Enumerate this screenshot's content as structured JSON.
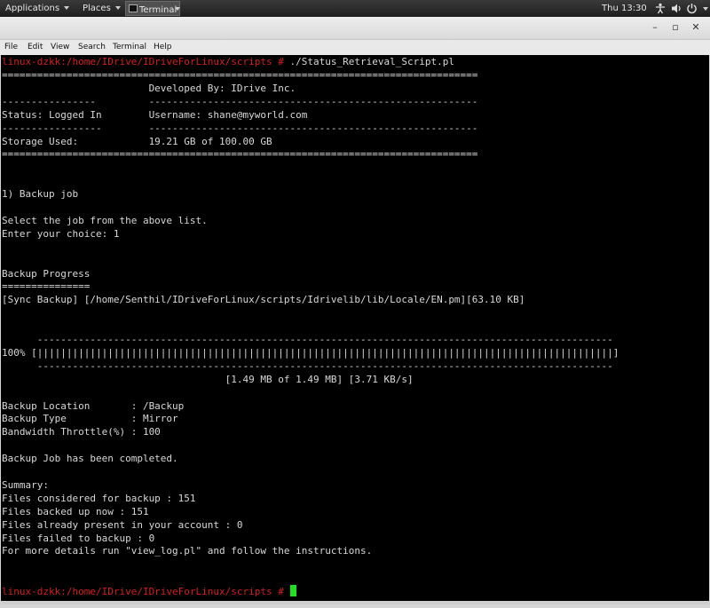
{
  "topbar": {
    "applications": "Applications",
    "places": "Places",
    "terminal_task": "Terminal",
    "clock": "Thu 13:30",
    "tray_icons": [
      "accessibility-icon",
      "volume-icon",
      "power-icon"
    ]
  },
  "window": {
    "controls": [
      "minimize-icon",
      "maximize-icon",
      "close-icon"
    ]
  },
  "menubar": {
    "items": [
      "File",
      "Edit",
      "View",
      "Search",
      "Terminal",
      "Help"
    ]
  },
  "terminal": {
    "prompt": "linux-dzkk:/home/IDrive/IDriveForLinux/scripts # ",
    "command": "./Status_Retrieval_Script.pl",
    "lines": [
      "=================================================================================",
      "                         Developed By: IDrive Inc.",
      "----------------         --------------------------------------------------------",
      "Status: Logged In        Username: shane@myworld.com",
      "-----------------        --------------------------------------------------------",
      "Storage Used:            19.21 GB of 100.00 GB",
      "=================================================================================",
      "",
      "",
      "1) Backup job",
      "",
      "Select the job from the above list.",
      "Enter your choice: 1",
      "",
      "",
      "Backup Progress",
      "===============",
      "[Sync Backup] [/home/Senthil/IDriveForLinux/scripts/Idrivelib/lib/Locale/EN.pm][63.10 KB]",
      "",
      "",
      "      --------------------------------------------------------------------------------------------------",
      "100% [||||||||||||||||||||||||||||||||||||||||||||||||||||||||||||||||||||||||||||||||||||||||||||||||||]",
      "      --------------------------------------------------------------------------------------------------",
      "                                      [1.49 MB of 1.49 MB] [3.71 KB/s]",
      "",
      "Backup Location       : /Backup",
      "Backup Type           : Mirror",
      "Bandwidth Throttle(%) : 100",
      "",
      "Backup Job has been completed.",
      "",
      "Summary:",
      "Files considered for backup : 151",
      "Files backed up now : 151",
      "Files already present in your account : 0",
      "Files failed to backup : 0",
      "For more details run \"view_log.pl\" and follow the instructions.",
      "",
      ""
    ],
    "final_prompt": "linux-dzkk:/home/IDrive/IDriveForLinux/scripts # "
  },
  "colors": {
    "prompt": "#d61e1e",
    "text": "#d8d8d8",
    "background": "#000000",
    "cursor": "#20e020"
  }
}
